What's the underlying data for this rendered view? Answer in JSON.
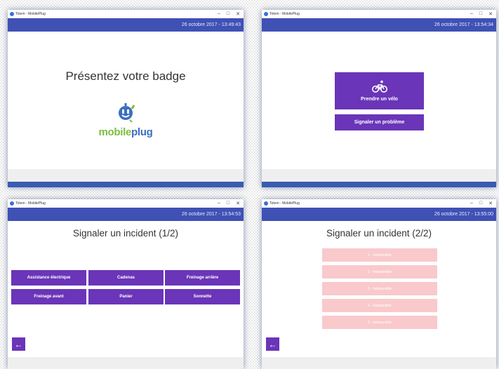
{
  "window_title": "Totem - MobilePlug",
  "window_controls": {
    "minimize": "–",
    "maximize": "□",
    "close": "✕"
  },
  "screen1": {
    "datetime": "26 octobre 2017 - 13:49:43",
    "title": "Présentez votre badge",
    "logo": {
      "part1": "mobile",
      "part2": "plug"
    }
  },
  "screen2": {
    "datetime": "26 octobre 2017 - 13:54:34",
    "take_bike_label": "Prendre un vélo",
    "report_problem_label": "Signaler un problème",
    "bike_icon": "bicycle-icon"
  },
  "screen3": {
    "datetime": "26 octobre 2017 - 13:54:53",
    "title": "Signaler un incident (1/2)",
    "options": [
      "Assistance électrique",
      "Cadenas",
      "Freinage arrière",
      "Freinage avant",
      "Panier",
      "Sonnette"
    ],
    "back_icon": "arrow-left-icon"
  },
  "screen4": {
    "datetime": "26 octobre 2017 - 13:55:00",
    "title": "Signaler un incident (2/2)",
    "slots": [
      "1 - Indisponible",
      "2 - Indisponible",
      "3 - Indisponible",
      "4 - Indisponible",
      "5 - Indisponible"
    ],
    "back_icon": "arrow-left-icon"
  },
  "colors": {
    "appbar": "#3f51b5",
    "button": "#6a35b8",
    "unavailable": "#f9c9cc",
    "logo_green": "#7cbd3f",
    "logo_blue": "#3b6fc0"
  }
}
